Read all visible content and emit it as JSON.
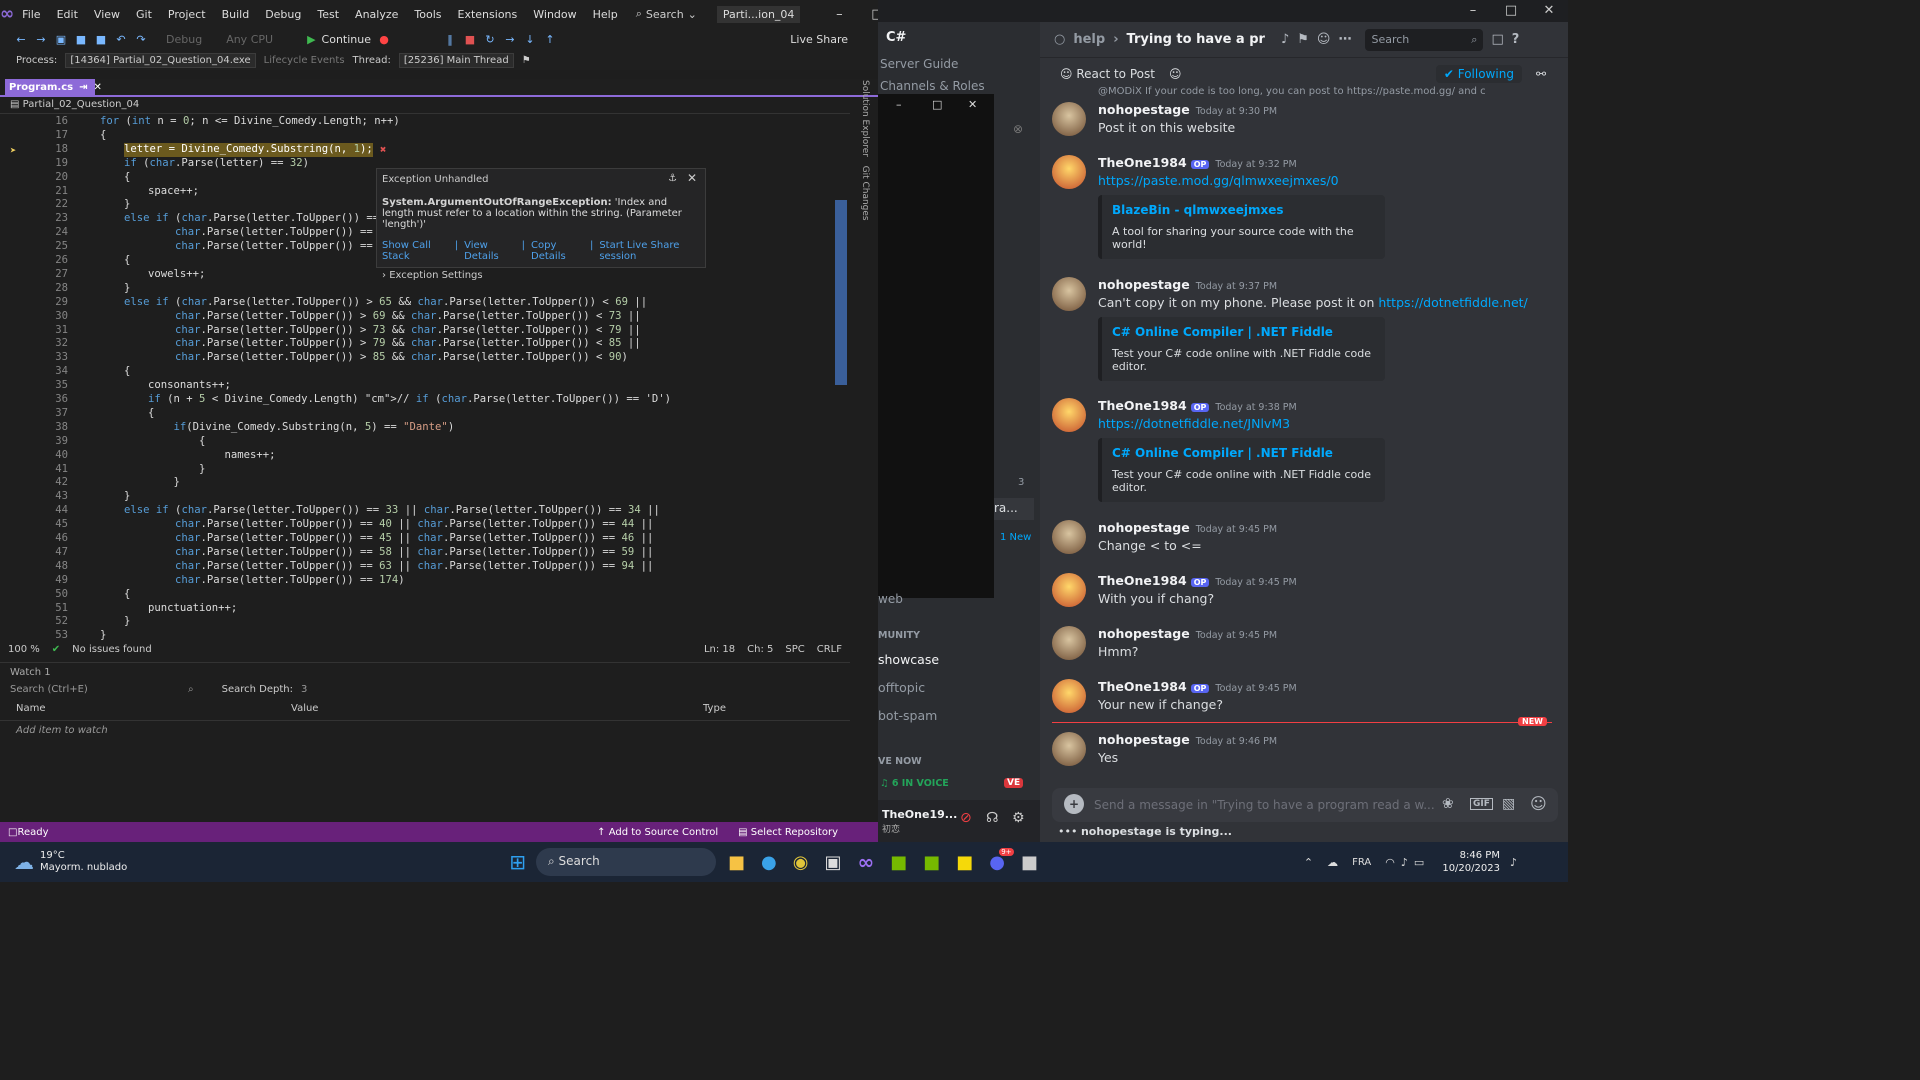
{
  "vs": {
    "menu": [
      "File",
      "Edit",
      "View",
      "Git",
      "Project",
      "Build",
      "Debug",
      "Test",
      "Analyze",
      "Tools",
      "Extensions",
      "Window",
      "Help"
    ],
    "search": "Search",
    "title": "Parti...ion_04",
    "toolbar": {
      "config": "Debug",
      "platform": "Any CPU",
      "continue": "Continue",
      "liveshare": "Live Share"
    },
    "process": {
      "label": "Process:",
      "value": "[14364] Partial_02_Question_04.exe",
      "lifecycle": "Lifecycle Events",
      "thread_label": "Thread:",
      "thread": "[25236] Main Thread"
    },
    "tab": {
      "name": "Program.cs",
      "pin": "⇥"
    },
    "nav": "Partial_02_Question_04",
    "side_labels": [
      "Solution Explorer",
      "Git Changes"
    ],
    "code": [
      {
        "n": "16",
        "t": "for (int n = 0; n <= Divine_Comedy.Length; n++)",
        "indent": 0
      },
      {
        "n": "17",
        "t": "{",
        "indent": 0
      },
      {
        "n": "18",
        "t": "letter = Divine_Comedy.Substring(n, 1);",
        "indent": 1
      },
      {
        "n": "19",
        "t": "if (char.Parse(letter) == 32)",
        "indent": 1
      },
      {
        "n": "20",
        "t": "{",
        "indent": 1
      },
      {
        "n": "21",
        "t": "space++;",
        "indent": 2
      },
      {
        "n": "22",
        "t": "}",
        "indent": 1
      },
      {
        "n": "23",
        "t": "else if (char.Parse(letter.ToUpper()) ==",
        "indent": 1
      },
      {
        "n": "24",
        "t": "        char.Parse(letter.ToUpper()) ==",
        "indent": 1
      },
      {
        "n": "25",
        "t": "        char.Parse(letter.ToUpper()) ==",
        "indent": 1
      },
      {
        "n": "26",
        "t": "{",
        "indent": 1
      },
      {
        "n": "27",
        "t": "vowels++;",
        "indent": 2
      },
      {
        "n": "28",
        "t": "}",
        "indent": 1
      },
      {
        "n": "29",
        "t": "else if (char.Parse(letter.ToUpper()) > 65 && char.Parse(letter.ToUpper()) < 69 ||",
        "indent": 1
      },
      {
        "n": "30",
        "t": "        char.Parse(letter.ToUpper()) > 69 && char.Parse(letter.ToUpper()) < 73 ||",
        "indent": 1
      },
      {
        "n": "31",
        "t": "        char.Parse(letter.ToUpper()) > 73 && char.Parse(letter.ToUpper()) < 79 ||",
        "indent": 1
      },
      {
        "n": "32",
        "t": "        char.Parse(letter.ToUpper()) > 79 && char.Parse(letter.ToUpper()) < 85 ||",
        "indent": 1
      },
      {
        "n": "33",
        "t": "        char.Parse(letter.ToUpper()) > 85 && char.Parse(letter.ToUpper()) < 90)",
        "indent": 1
      },
      {
        "n": "34",
        "t": "{",
        "indent": 1
      },
      {
        "n": "35",
        "t": "consonants++;",
        "indent": 2
      },
      {
        "n": "36",
        "t": "if (n + 5 < Divine_Comedy.Length) // if (char.Parse(letter.ToUpper()) == 'D')",
        "indent": 2
      },
      {
        "n": "37",
        "t": "{",
        "indent": 2
      },
      {
        "n": "38",
        "t": "    if(Divine_Comedy.Substring(n, 5) == \"Dante\")",
        "indent": 2
      },
      {
        "n": "39",
        "t": "        {",
        "indent": 2
      },
      {
        "n": "40",
        "t": "            names++;",
        "indent": 2
      },
      {
        "n": "41",
        "t": "        }",
        "indent": 2
      },
      {
        "n": "42",
        "t": "    }",
        "indent": 2
      },
      {
        "n": "43",
        "t": "}",
        "indent": 1
      },
      {
        "n": "44",
        "t": "else if (char.Parse(letter.ToUpper()) == 33 || char.Parse(letter.ToUpper()) == 34 ||",
        "indent": 1
      },
      {
        "n": "45",
        "t": "        char.Parse(letter.ToUpper()) == 40 || char.Parse(letter.ToUpper()) == 44 ||",
        "indent": 1
      },
      {
        "n": "46",
        "t": "        char.Parse(letter.ToUpper()) == 45 || char.Parse(letter.ToUpper()) == 46 ||",
        "indent": 1
      },
      {
        "n": "47",
        "t": "        char.Parse(letter.ToUpper()) == 58 || char.Parse(letter.ToUpper()) == 59 ||",
        "indent": 1
      },
      {
        "n": "48",
        "t": "        char.Parse(letter.ToUpper()) == 63 || char.Parse(letter.ToUpper()) == 94 ||",
        "indent": 1
      },
      {
        "n": "49",
        "t": "        char.Parse(letter.ToUpper()) == 174)",
        "indent": 1
      },
      {
        "n": "50",
        "t": "{",
        "indent": 1
      },
      {
        "n": "51",
        "t": "punctuation++;",
        "indent": 2
      },
      {
        "n": "52",
        "t": "}",
        "indent": 1
      },
      {
        "n": "53",
        "t": "}",
        "indent": 0
      }
    ],
    "exception": {
      "title": "Exception Unhandled",
      "type": "System.ArgumentOutOfRangeException:",
      "message": "'Index and length must refer to a location within the string. (Parameter 'length')'",
      "links": [
        "Show Call Stack",
        "View Details",
        "Copy Details",
        "Start Live Share session"
      ],
      "settings": "Exception Settings"
    },
    "status": {
      "zoom": "100 %",
      "issues": "No issues found",
      "ln": "Ln: 18",
      "ch": "Ch: 5",
      "spc": "SPC",
      "crlf": "CRLF"
    },
    "watch": {
      "title": "Watch 1",
      "search": "Search (Ctrl+E)",
      "depth_label": "Search Depth:",
      "depth": "3",
      "cols": [
        "Name",
        "Value",
        "Type"
      ],
      "add": "Add item to watch"
    },
    "statusbar": {
      "ready": "Ready",
      "source": "Add to Source Control",
      "repo": "Select Repository"
    }
  },
  "discord": {
    "channel": "help",
    "thread": "Trying to have a pr",
    "search": "Search",
    "server": "C#",
    "sidebar": [
      "Server Guide",
      "Channels & Roles",
      "web",
      "MUNITY",
      "showcase",
      "offtopic",
      "bot-spam",
      "VE NOW"
    ],
    "sidebar_extra": {
      "count": "3",
      "new": "1 New",
      "thread_frag": "ra..."
    },
    "voice": "6 IN VOICE",
    "live": "VE",
    "user": {
      "name": "TheOne19...",
      "status": "初恋"
    },
    "react": "React to Post",
    "following": "Following",
    "top_snip": "@MODiX If your code is too long, you can post to https://paste.mod.gg/ and c",
    "messages": [
      {
        "user": "nohopestage",
        "time": "Today at 9:30 PM",
        "text": "Post it on this website",
        "av": 1
      },
      {
        "user": "TheOne1984",
        "time": "Today at 9:32 PM",
        "text": "https://paste.mod.gg/qlmwxeejmxes/0",
        "av": 2,
        "op": "OP",
        "link": true,
        "embed": {
          "title": "BlazeBin - qlmwxeejmxes",
          "desc": "A tool for sharing your source code with the world!"
        }
      },
      {
        "user": "nohopestage",
        "time": "Today at 9:37 PM",
        "text": "Can't copy it on my phone. Please post it on ",
        "link_text": "https://dotnetfiddle.net/",
        "av": 1,
        "embed": {
          "title": "C# Online Compiler | .NET Fiddle",
          "desc": "Test your C# code online with .NET Fiddle code editor."
        }
      },
      {
        "user": "TheOne1984",
        "time": "Today at 9:38 PM",
        "text": "https://dotnetfiddle.net/JNlvM3",
        "av": 2,
        "op": "OP",
        "link": true,
        "embed": {
          "title": "C# Online Compiler | .NET Fiddle",
          "desc": "Test your C# code online with .NET Fiddle code editor."
        }
      },
      {
        "user": "nohopestage",
        "time": "Today at 9:45 PM",
        "text": "Change < to <=",
        "av": 1
      },
      {
        "user": "TheOne1984",
        "time": "Today at 9:45 PM",
        "text": "With you if chang?",
        "av": 2,
        "op": "OP"
      },
      {
        "user": "nohopestage",
        "time": "Today at 9:45 PM",
        "text": "Hmm?",
        "av": 1
      },
      {
        "user": "TheOne1984",
        "time": "Today at 9:45 PM",
        "text": "Your new if change?",
        "av": 2,
        "op": "OP"
      },
      {
        "user": "nohopestage",
        "time": "Today at 9:46 PM",
        "text": "Yes",
        "av": 1
      }
    ],
    "new_badge": "NEW",
    "input": "Send a message in \"Trying to have a program read a w...",
    "typing": "nohopestage is typing...",
    "gif": "GIF"
  },
  "taskbar": {
    "temp": "19°C",
    "weather": "Mayorm. nublado",
    "search": "Search",
    "lang": "FRA",
    "time": "8:46 PM",
    "date": "10/20/2023",
    "discord_badge": "9+"
  }
}
